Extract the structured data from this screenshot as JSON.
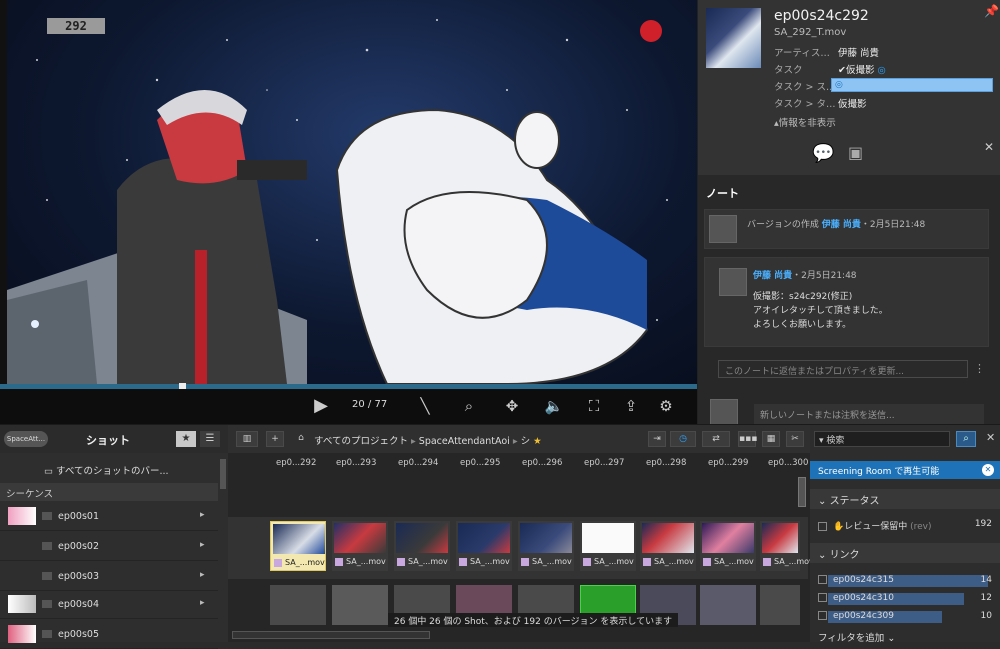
{
  "viewer": {
    "frame_number": "292",
    "frame_counter": "20 / 77",
    "progress": 0.26,
    "controls": [
      "play",
      "annotate",
      "zoom",
      "pan",
      "volume",
      "fullscreen",
      "share",
      "settings"
    ]
  },
  "info": {
    "shot_code": "ep00s24c292",
    "file_name": "SA_292_T.mov",
    "fields": [
      {
        "label": "アーティス…",
        "value": "伊藤 尚貴"
      },
      {
        "label": "タスク",
        "value": "仮撮影"
      },
      {
        "label": "タスク > ス…",
        "value": ""
      },
      {
        "label": "タスク > タ…",
        "value": "仮撮影"
      }
    ],
    "hide_info": "▴情報を非表示"
  },
  "notes": {
    "header": "ノート",
    "entries": [
      {
        "text_prefix": "バージョンの作成",
        "author": "伊藤 尚貴",
        "date": "・2月5日21:48"
      },
      {
        "author": "伊藤 尚貴",
        "date": "・2月5日21:48",
        "body": [
          "仮撮影：s24c292(修正)",
          "アオイレタッチして頂きました。",
          "よろしくお願いします。"
        ]
      }
    ],
    "reply_placeholder": "このノートに返信またはプロパティを更新...",
    "new_note_placeholder": "新しいノートまたは注釈を送信..."
  },
  "shots_panel": {
    "project_btn": "SpaceAtt...",
    "title": "ショット",
    "all_versions": "すべてのショットのバー...",
    "section": "シーケンス",
    "sequences": [
      "ep00s01",
      "ep00s02",
      "ep00s03",
      "ep00s04",
      "ep00s05"
    ]
  },
  "grid": {
    "breadcrumb": [
      "すべてのプロジェクト",
      "SpaceAttendantAoi",
      "シ"
    ],
    "columns": [
      "ep0...292",
      "ep0...293",
      "ep0...294",
      "ep0...295",
      "ep0...296",
      "ep0...297",
      "ep0...298",
      "ep0...299",
      "ep0...300"
    ],
    "card_label": "SA_...mov",
    "first_card_label": "SA_...mov",
    "status": "26 個中 26 個の Shot、および 192 のバージョン を表示しています"
  },
  "filter": {
    "search_placeholder": "検索",
    "screening": "Screening Room で再生可能",
    "status_section": "ステータス",
    "status_item": {
      "label": "レビュー保留中",
      "suffix": "(rev)",
      "count": "192"
    },
    "links_section": "リンク",
    "links": [
      {
        "label": "ep00s24c315",
        "count": "14"
      },
      {
        "label": "ep00s24c310",
        "count": "12"
      },
      {
        "label": "ep00s24c309",
        "count": "10"
      }
    ],
    "add_filter": "フィルタを追加 ⌄"
  },
  "colors": {
    "accent": "#1e73b8",
    "record": "#d0202a"
  }
}
